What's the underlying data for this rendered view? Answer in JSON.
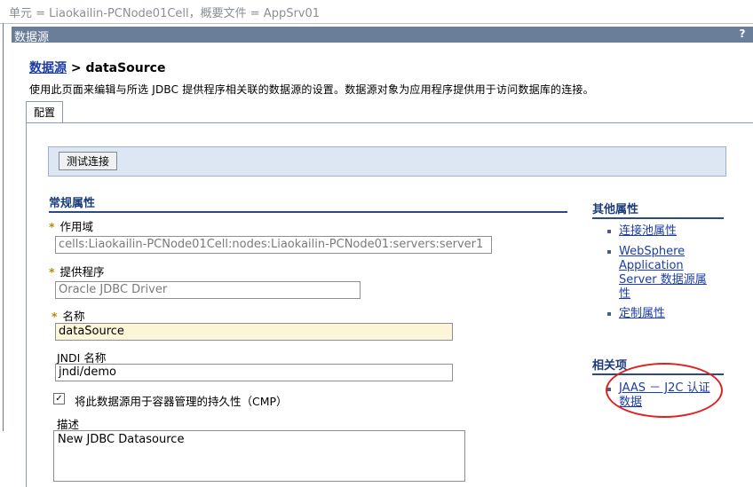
{
  "topbar": {
    "scope_text": "单元 = Liaokailin-PCNode01Cell，概要文件 = AppSrv01"
  },
  "panel": {
    "title": "数据源",
    "help": "?"
  },
  "breadcrumb": {
    "link": "数据源",
    "separator": " > ",
    "current": "dataSource"
  },
  "description": "使用此页面来编辑与所选 JDBC 提供程序相关联的数据源的设置。数据源对象为应用程序提供用于访问数据库的连接。",
  "tabs": [
    {
      "label": "配置"
    }
  ],
  "toolbar": {
    "test_connection": "测试连接"
  },
  "general": {
    "heading": "常规属性",
    "required_mark": "*",
    "scope_label": "作用域",
    "scope_value": "cells:Liaokailin-PCNode01Cell:nodes:Liaokailin-PCNode01:servers:server1",
    "provider_label": "提供程序",
    "provider_value": "Oracle JDBC Driver",
    "name_label": "名称",
    "name_value": "dataSource",
    "jndi_label": "JNDI 名称",
    "jndi_value": "jndi/demo",
    "cmp_checkbox_label": "将此数据源用于容器管理的持久性（CMP）",
    "cmp_checked": true,
    "desc_label": "描述",
    "desc_value": "New JDBC Datasource"
  },
  "other_props": {
    "heading": "其他属性",
    "links": [
      "连接池属性",
      "WebSphere Application Server 数据源属性",
      "定制属性"
    ]
  },
  "related": {
    "heading": "相关项",
    "links": [
      "JAAS － J2C 认证数据"
    ]
  },
  "colors": {
    "header_bg": "#6a7d99",
    "link": "#1c3ca8",
    "highlight_oval": "#e02020"
  }
}
